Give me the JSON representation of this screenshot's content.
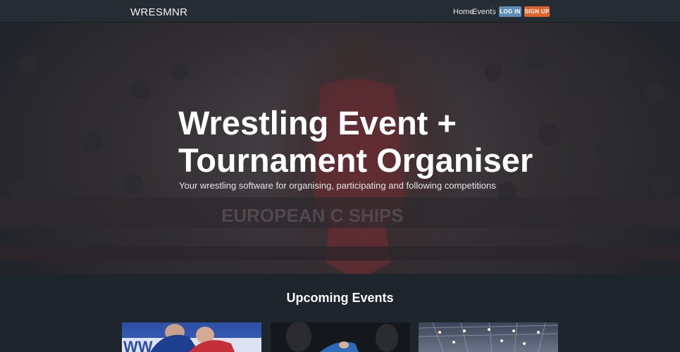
{
  "nav": {
    "brand": "WRESMNR",
    "links": [
      "Home",
      "Events"
    ],
    "login_label": "LOG IN",
    "signup_label": "SIGN UP"
  },
  "hero": {
    "title_line1": "Wrestling Event +",
    "title_line2": "Tournament Organiser",
    "subtitle": "Your wrestling software for organising, participating and following competitions",
    "background_banner_text": "EUROPEAN C   SHIPS"
  },
  "events": {
    "heading": "Upcoming Events",
    "cards": [
      {
        "image": "wrestlers-blue-mat-photo",
        "banner_text": "WW"
      },
      {
        "image": "wrestlers-dark-arena-photo"
      },
      {
        "image": "arena-ceiling-lights-photo"
      }
    ]
  },
  "colors": {
    "navbar": "#262c33",
    "page_bg": "#1f252c",
    "login_button": "#5f8fb8",
    "signup_button": "#e0622c"
  }
}
